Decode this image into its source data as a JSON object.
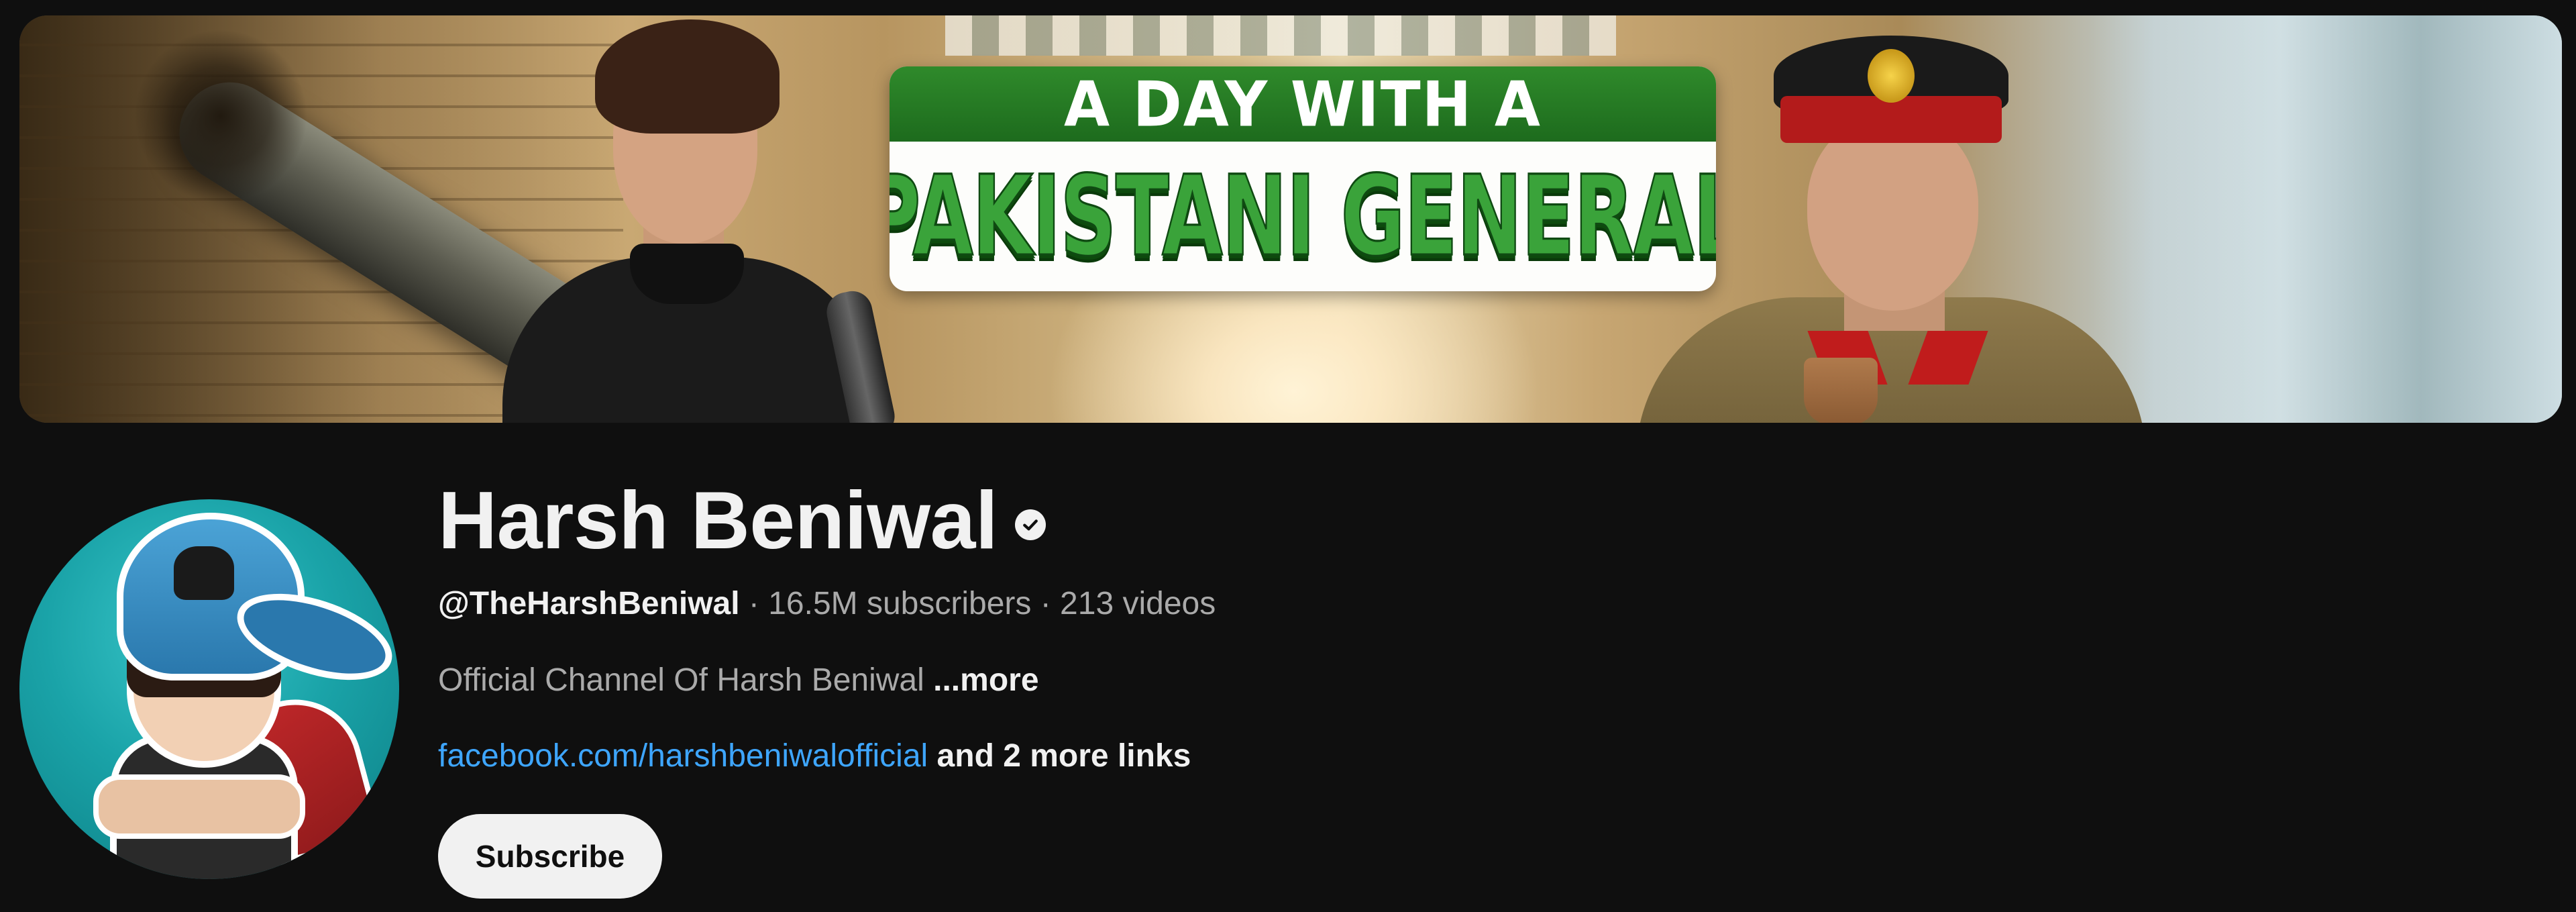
{
  "banner": {
    "title_line1": "A DAY WITH A",
    "title_line2": "PAKISTANI GENERAL"
  },
  "channel": {
    "name": "Harsh Beniwal",
    "verified_icon": "verified-checkmark-icon",
    "handle": "@TheHarshBeniwal",
    "separator": " · ",
    "subscribers": "16.5M subscribers",
    "videos": "213 videos",
    "description": "Official Channel Of Harsh Beniwal",
    "more_label": "...more",
    "link_text": "facebook.com/harshbeniwalofficial",
    "more_links_label": "and 2 more links",
    "subscribe_label": "Subscribe"
  },
  "colors": {
    "background": "#0f0f0f",
    "primary_text": "#f1f1f1",
    "secondary_text": "#aaaaaa",
    "link": "#3ea6ff",
    "button_bg": "#f1f1f1"
  }
}
